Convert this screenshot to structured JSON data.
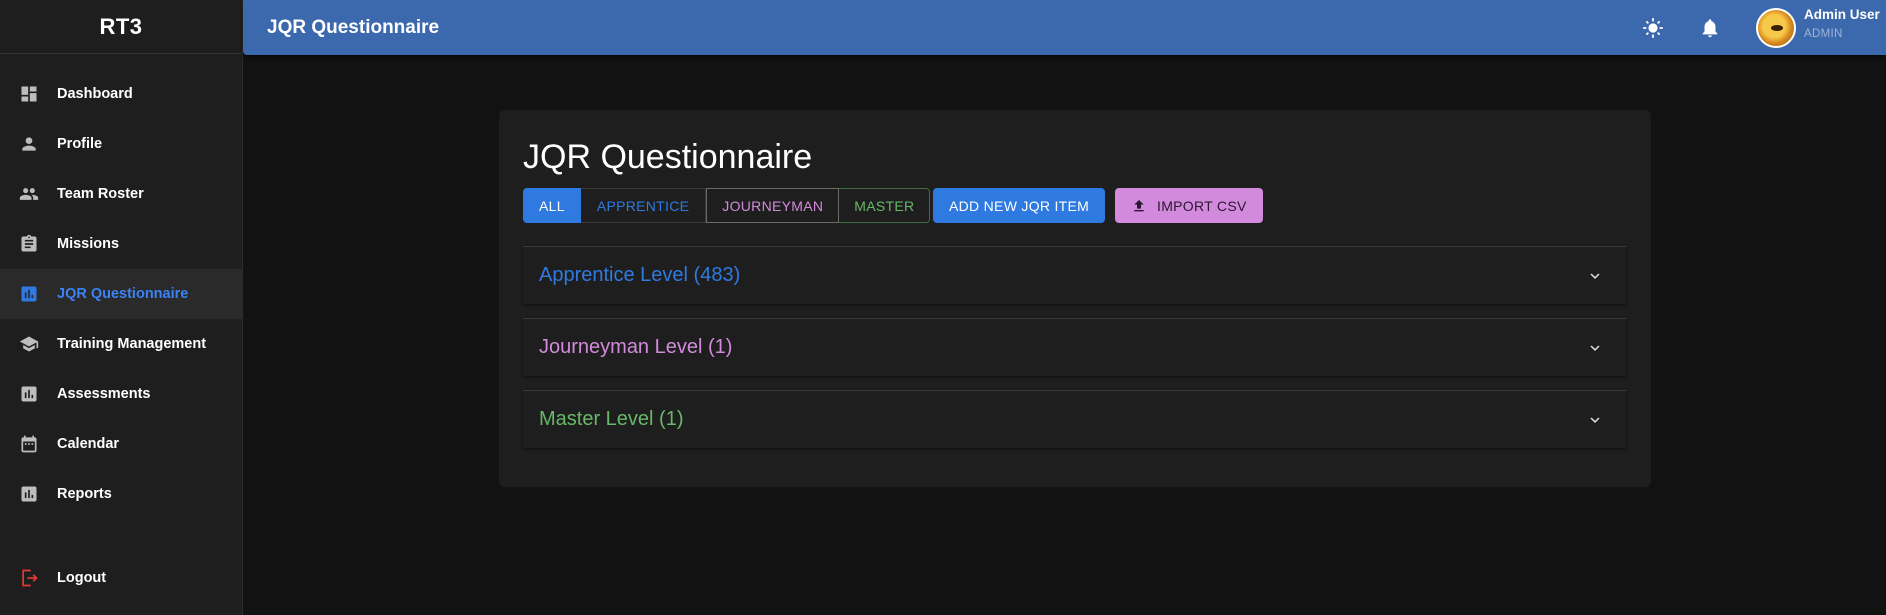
{
  "app": {
    "brand": "RT3"
  },
  "sidebar": {
    "items": [
      {
        "label": "Dashboard",
        "icon": "dashboard-icon"
      },
      {
        "label": "Profile",
        "icon": "person-icon"
      },
      {
        "label": "Team Roster",
        "icon": "group-icon"
      },
      {
        "label": "Missions",
        "icon": "clipboard-icon"
      },
      {
        "label": "JQR Questionnaire",
        "icon": "bar-chart-icon",
        "active": true
      },
      {
        "label": "Training Management",
        "icon": "school-icon"
      },
      {
        "label": "Assessments",
        "icon": "assessment-icon"
      },
      {
        "label": "Calendar",
        "icon": "calendar-icon"
      },
      {
        "label": "Reports",
        "icon": "reports-icon"
      }
    ],
    "logout": {
      "label": "Logout",
      "icon": "logout-icon"
    }
  },
  "topbar": {
    "title": "JQR Questionnaire",
    "user": {
      "name": "Admin User",
      "role": "ADMIN"
    }
  },
  "main": {
    "title": "JQR Questionnaire",
    "filters": [
      "ALL",
      "APPRENTICE",
      "JOURNEYMAN",
      "MASTER"
    ],
    "selected_filter": "ALL",
    "add_button": "ADD NEW JQR ITEM",
    "import_button": "IMPORT CSV",
    "sections": [
      {
        "label": "Apprentice Level (483)",
        "color": "#2f7ae0"
      },
      {
        "label": "Journeyman Level (1)",
        "color": "#d28bdc"
      },
      {
        "label": "Master Level (1)",
        "color": "#67b868"
      }
    ]
  },
  "colors": {
    "primary": "#2f7ae0",
    "journeyman": "#d28bdc",
    "master": "#67b868",
    "topbar": "#3c69ad",
    "logout": "#e53935"
  }
}
